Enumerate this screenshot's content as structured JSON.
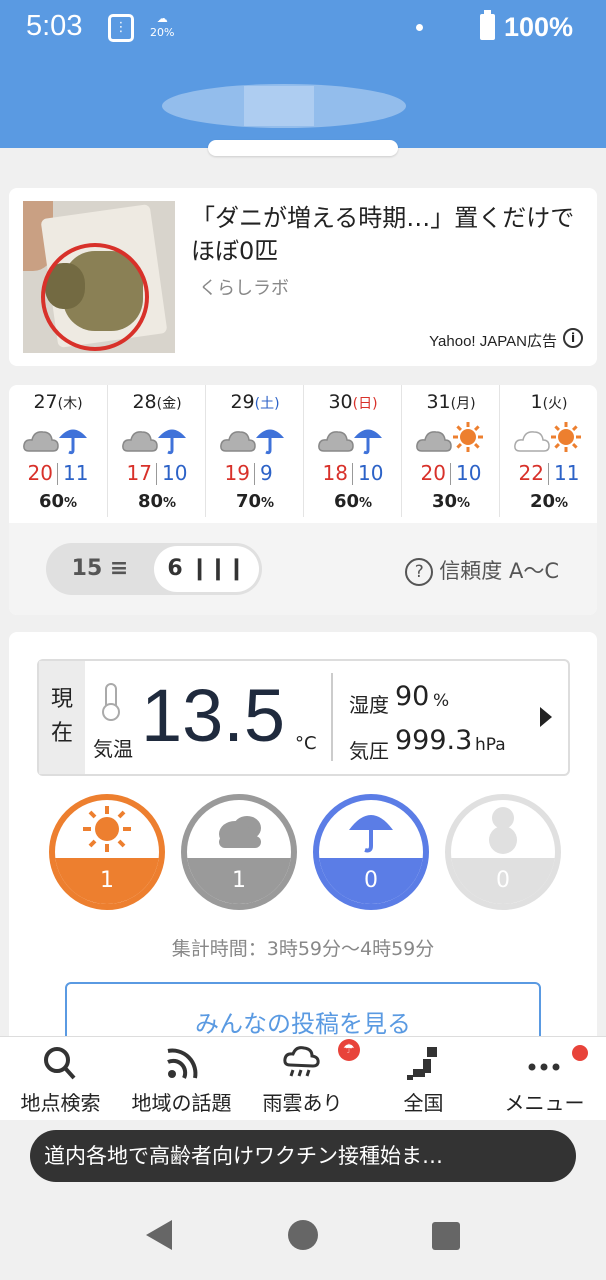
{
  "status_bar": {
    "time": "5:03",
    "weather_pct": "20%",
    "battery": "100%"
  },
  "ad": {
    "title": "「ダニが増える時期…」置くだけでほぼ0匹",
    "source": "くらしラボ",
    "label": "Yahoo! JAPAN広告"
  },
  "forecast": {
    "days": [
      {
        "day": "27",
        "weekday": "(木)",
        "high": "20",
        "low": "11",
        "pop": "60",
        "icon": "cloud-rain-icon"
      },
      {
        "day": "28",
        "weekday": "(金)",
        "high": "17",
        "low": "10",
        "pop": "80",
        "icon": "cloud-rain-icon"
      },
      {
        "day": "29",
        "weekday": "(土)",
        "high": "19",
        "low": "9",
        "pop": "70",
        "icon": "cloud-rain-icon"
      },
      {
        "day": "30",
        "weekday": "(日)",
        "high": "18",
        "low": "10",
        "pop": "60",
        "icon": "cloud-rain-icon"
      },
      {
        "day": "31",
        "weekday": "(月)",
        "high": "20",
        "low": "10",
        "pop": "30",
        "icon": "cloud-sun-icon"
      },
      {
        "day": "1",
        "weekday": "(火)",
        "high": "22",
        "low": "11",
        "pop": "20",
        "icon": "cloud-sun-icon"
      }
    ],
    "pop_unit": "%",
    "toggle_15": "15",
    "toggle_6": "6",
    "reliability": "信頼度 A〜C"
  },
  "current": {
    "side_label_1": "現",
    "side_label_2": "在",
    "temp_label": "気温",
    "temp": "13.5",
    "temp_unit": "°C",
    "humidity_label": "湿度",
    "humidity": "90",
    "humidity_unit": "%",
    "pressure_label": "気圧",
    "pressure": "999.3",
    "pressure_unit": "hPa"
  },
  "votes": {
    "sunny": "1",
    "cloudy": "1",
    "rainy": "0",
    "snowy": "0"
  },
  "aggregate_time": "集計時間：3時59分〜4時59分",
  "posts_button": "みんなの投稿を見る",
  "nav": {
    "search": "地点検索",
    "topics": "地域の話題",
    "rain": "雨雲あり",
    "national": "全国",
    "menu": "メニュー"
  },
  "toast": "道内各地で高齢者向けワクチン接種始ま…",
  "colors": {
    "header": "#5a9ae2",
    "high": "#d8312a",
    "low": "#2c62c7",
    "sunny": "#ed7f2f",
    "rainy": "#5b7de6"
  }
}
